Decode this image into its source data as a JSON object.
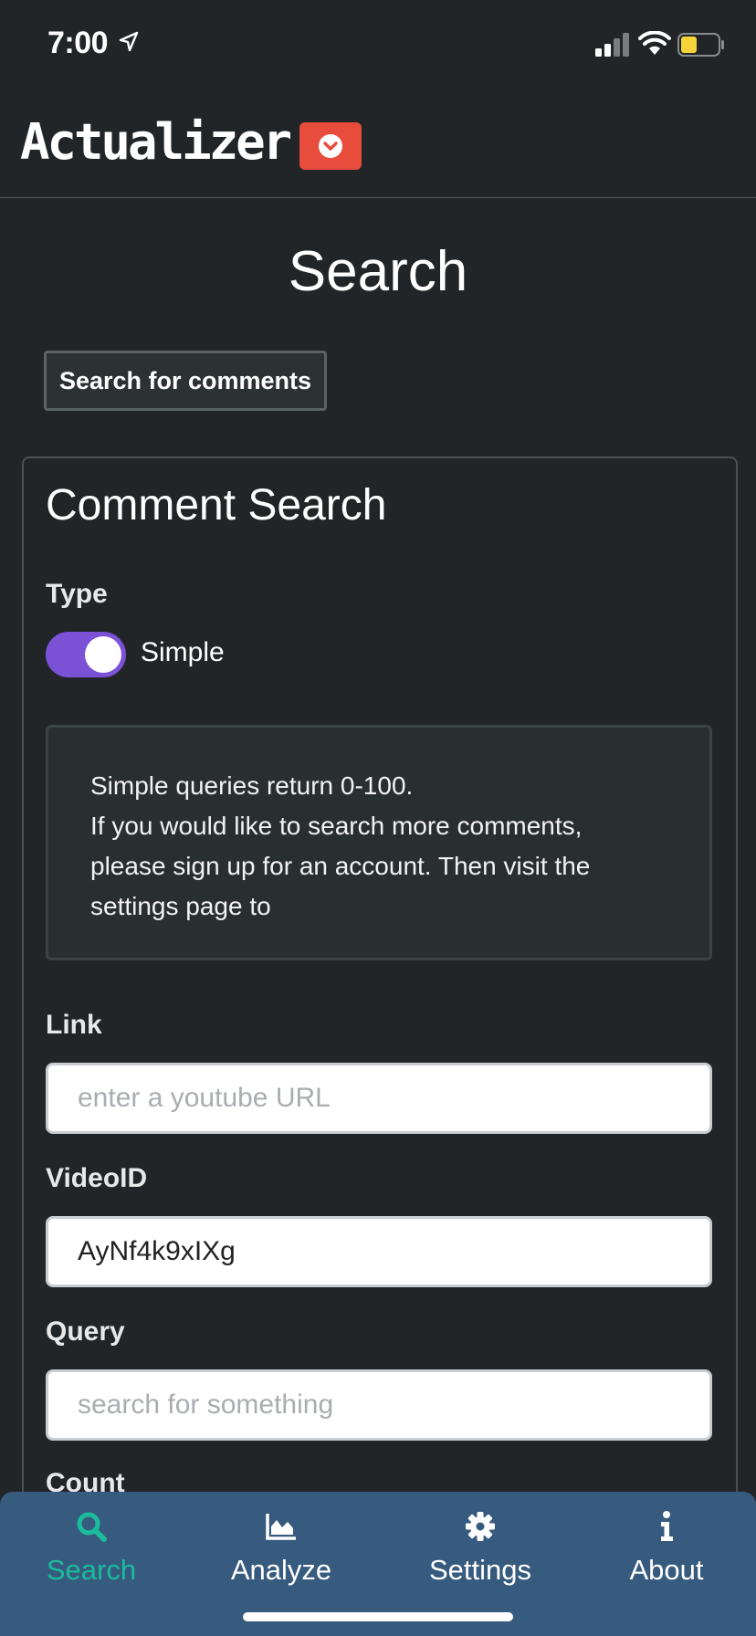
{
  "status": {
    "time": "7:00"
  },
  "header": {
    "logo": "Actualizer",
    "menu_toggle_icon": "chevron-down-circle-icon",
    "menu_toggle_color": "#e74c3c"
  },
  "page": {
    "title": "Search",
    "search_comments_button": "Search for comments"
  },
  "card": {
    "title": "Comment Search",
    "type_label": "Type",
    "type_toggle": {
      "on": true,
      "label": "Simple",
      "color": "#7b52d6"
    },
    "info_lines": [
      "Simple queries return 0-100.",
      "If you would like to search more comments,",
      "please sign up for an account. Then visit the",
      "settings page to"
    ],
    "link": {
      "label": "Link",
      "value": "",
      "placeholder": "enter a youtube URL"
    },
    "video_id": {
      "label": "VideoID",
      "value": "AyNf4k9xIXg",
      "placeholder": ""
    },
    "query": {
      "label": "Query",
      "value": "",
      "placeholder": "search for something"
    },
    "count": {
      "label": "Count"
    }
  },
  "bottom_nav": {
    "background": "#375a7f",
    "active_color": "#1abc9c",
    "items": [
      {
        "label": "Search",
        "icon": "search-icon",
        "active": true
      },
      {
        "label": "Analyze",
        "icon": "area-chart-icon",
        "active": false
      },
      {
        "label": "Settings",
        "icon": "gear-icon",
        "active": false
      },
      {
        "label": "About",
        "icon": "info-icon",
        "active": false
      }
    ]
  }
}
